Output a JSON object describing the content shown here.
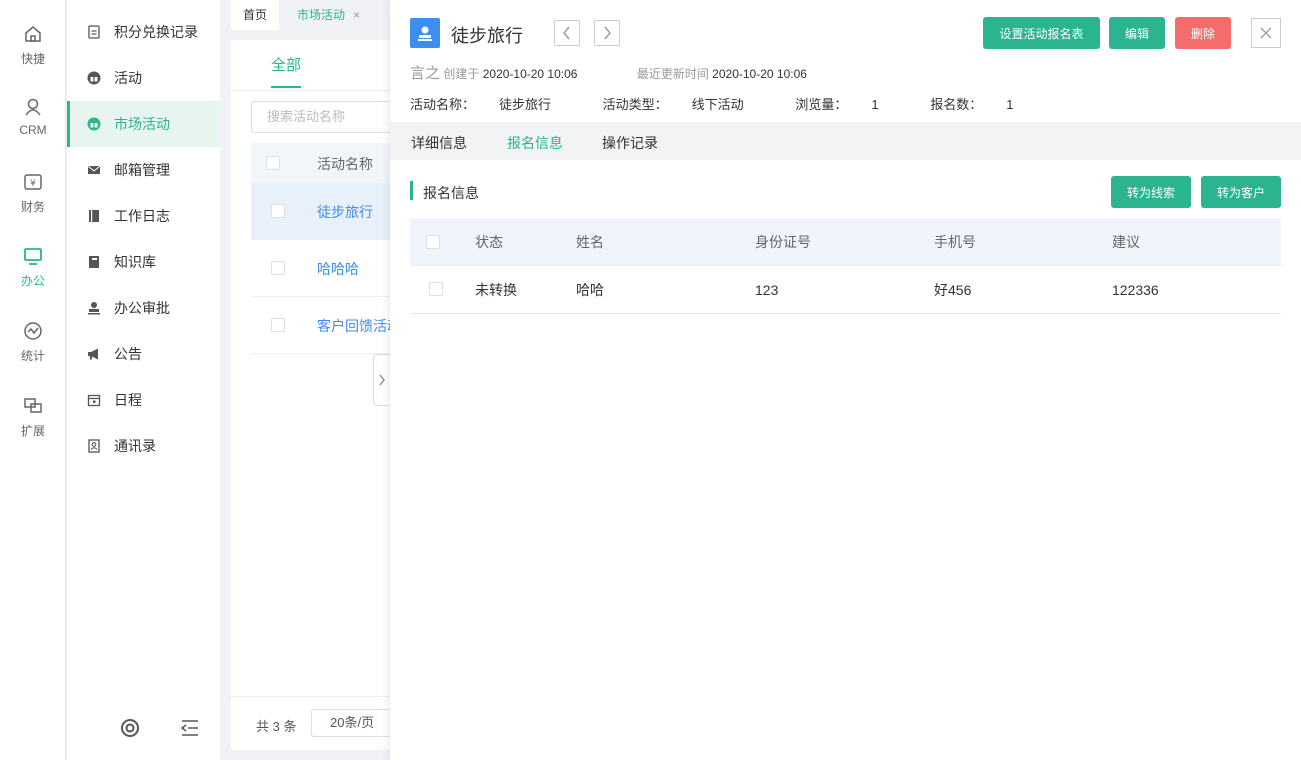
{
  "rail": [
    {
      "label": "快捷",
      "icon": "home-icon"
    },
    {
      "label": "CRM",
      "icon": "user-icon"
    },
    {
      "label": "财务",
      "icon": "finance-icon"
    },
    {
      "label": "办公",
      "icon": "monitor-icon",
      "active": true
    },
    {
      "label": "统计",
      "icon": "stats-icon"
    },
    {
      "label": "扩展",
      "icon": "extend-icon"
    }
  ],
  "sidebar": {
    "items": [
      {
        "label": "积分兑换记录",
        "icon": "points-icon"
      },
      {
        "label": "活动",
        "icon": "gift-icon"
      },
      {
        "label": "市场活动",
        "icon": "gift-icon",
        "active": true
      },
      {
        "label": "邮箱管理",
        "icon": "mail-icon"
      },
      {
        "label": "工作日志",
        "icon": "notebook-icon"
      },
      {
        "label": "知识库",
        "icon": "book-icon"
      },
      {
        "label": "办公审批",
        "icon": "stamp-icon"
      },
      {
        "label": "公告",
        "icon": "megaphone-icon"
      },
      {
        "label": "日程",
        "icon": "calendar-icon"
      },
      {
        "label": "通讯录",
        "icon": "contacts-icon"
      }
    ]
  },
  "tabs": [
    {
      "label": "首页"
    },
    {
      "label": "市场活动",
      "active": true,
      "close": "×"
    }
  ],
  "list": {
    "tab_all": "全部",
    "search_placeholder": "搜索活动名称",
    "col_name": "活动名称",
    "rows": [
      {
        "name": "徒步旅行",
        "selected": true
      },
      {
        "name": "哈哈哈"
      },
      {
        "name": "客户回馈活动"
      }
    ],
    "footer": {
      "total": "共 3 条",
      "page_size": "20条/页"
    }
  },
  "detail": {
    "title": "徒步旅行",
    "buttons": {
      "set_form": "设置活动报名表",
      "edit": "编辑",
      "delete": "删除"
    },
    "creator": "言之",
    "created_label": "创建于",
    "created_at": "2020-10-20 10:06",
    "updated_label": "最近更新时间",
    "updated_at": "2020-10-20 10:06",
    "info": {
      "name_label": "活动名称：",
      "name_value": "徒步旅行",
      "type_label": "活动类型：",
      "type_value": "线下活动",
      "views_label": "浏览量：",
      "views_value": "1",
      "signups_label": "报名数：",
      "signups_value": "1"
    },
    "tabs": [
      {
        "label": "详细信息"
      },
      {
        "label": "报名信息",
        "active": true
      },
      {
        "label": "操作记录"
      }
    ],
    "section_title": "报名信息",
    "actions": {
      "to_lead": "转为线索",
      "to_customer": "转为客户"
    },
    "table": {
      "columns": [
        "状态",
        "姓名",
        "身份证号",
        "手机号",
        "建议"
      ],
      "rows": [
        [
          "未转换",
          "哈哈",
          "123",
          "好456",
          "122336"
        ]
      ]
    }
  },
  "colors": {
    "accent": "#2bb48f",
    "danger": "#f56c6c",
    "link": "#3e8eef"
  }
}
